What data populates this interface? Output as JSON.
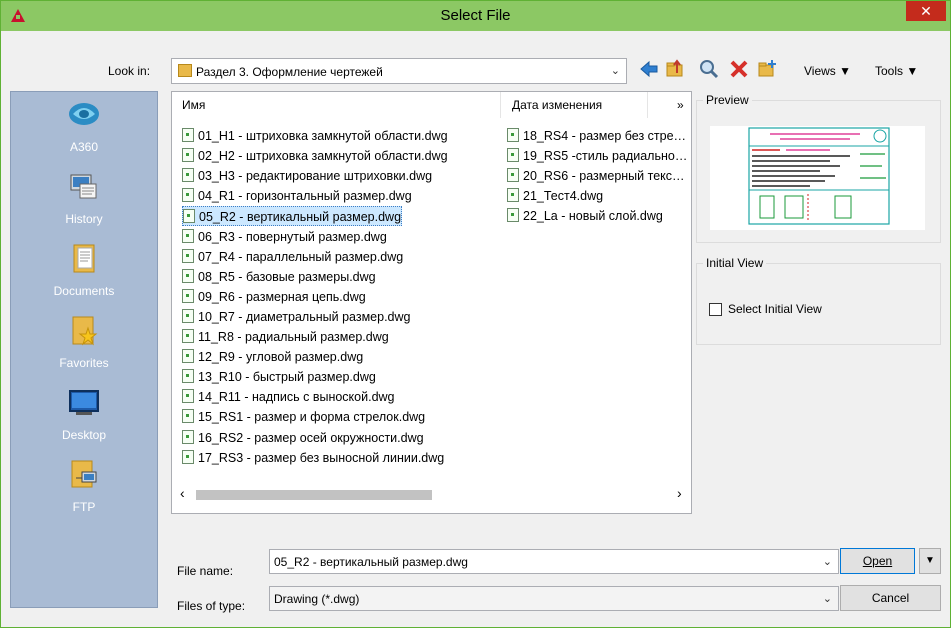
{
  "window": {
    "title": "Select File",
    "close_glyph": "✕"
  },
  "toolbar": {
    "look_in_label": "Look in:",
    "look_in_value": "Раздел 3. Оформление чертежей",
    "views_label": "Views",
    "tools_label": "Tools",
    "icons": [
      "back-icon",
      "up-folder-icon",
      "search-web-icon",
      "delete-icon",
      "new-folder-icon"
    ]
  },
  "places": [
    {
      "label": "A360",
      "icon": "a360-icon"
    },
    {
      "label": "History",
      "icon": "history-icon"
    },
    {
      "label": "Documents",
      "icon": "documents-icon"
    },
    {
      "label": "Favorites",
      "icon": "favorites-icon"
    },
    {
      "label": "Desktop",
      "icon": "desktop-icon"
    },
    {
      "label": "FTP",
      "icon": "ftp-icon"
    }
  ],
  "file_list": {
    "col_name": "Имя",
    "col_date": "Дата изменения",
    "more": "»",
    "column1": [
      "01_H1 - штриховка замкнутой области.dwg",
      "02_H2 - штриховка замкнутой области.dwg",
      "03_H3 - редактирование штриховки.dwg",
      "04_R1 - горизонтальный размер.dwg",
      "05_R2 - вертикальный размер.dwg",
      "06_R3 - повернутый размер.dwg",
      "07_R4 - параллельный размер.dwg",
      "08_R5 - базовые размеры.dwg",
      "09_R6 - размерная цепь.dwg",
      "10_R7 - диаметральный размер.dwg",
      "11_R8 - радиальный размер.dwg",
      "12_R9 - угловой размер.dwg",
      "13_R10 - быстрый размер.dwg",
      "14_R11 - надпись с выноской.dwg",
      "15_RS1 - размер и форма стрелок.dwg",
      "16_RS2 - размер осей окружности.dwg",
      "17_RS3 - размер без выносной линии.dwg"
    ],
    "column2": [
      "18_RS4 - размер без стре…",
      "19_RS5 -стиль радиально…",
      "20_RS6 - размерный текс…",
      "21_Тест4.dwg",
      "22_La - новый слой.dwg"
    ],
    "selected": "05_R2 - вертикальный размер.dwg",
    "scroll_left": "‹",
    "scroll_right": "›"
  },
  "preview": {
    "label": "Preview"
  },
  "initial_view": {
    "label": "Initial View",
    "checkbox_label": "Select Initial View",
    "checked": false
  },
  "bottom": {
    "file_name_label": "File name:",
    "file_name_value": "05_R2 - вертикальный размер.dwg",
    "files_of_type_label": "Files of type:",
    "files_of_type_value": "Drawing (*.dwg)",
    "open_label": "Open",
    "cancel_label": "Cancel"
  },
  "colors": {
    "titlebar": "#8cc864",
    "places_bg": "#a9bbd4",
    "selection": "#cce8ff",
    "close": "#c42b1c"
  }
}
